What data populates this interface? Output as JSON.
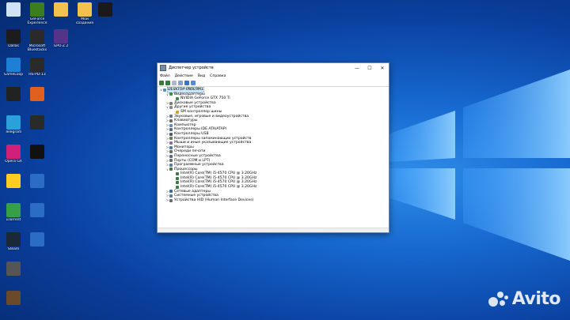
{
  "window": {
    "title": "Диспетчер устройств",
    "minimize_glyph": "—",
    "maximize_glyph": "☐",
    "close_glyph": "✕",
    "menu": [
      "Файл",
      "Действие",
      "Вид",
      "Справка"
    ]
  },
  "tree": [
    {
      "text": "DESKTOP-0N0E9M1",
      "level": 0,
      "expander": "∨",
      "icon": "computer-icon",
      "selected": true
    },
    {
      "text": "Видеоадаптеры",
      "level": 1,
      "expander": "∨",
      "icon": "display-adapter-icon"
    },
    {
      "text": "NVIDIA GeForce GTX 750 Ti",
      "level": 2,
      "expander": "",
      "icon": "display-adapter-icon"
    },
    {
      "text": "Дисковые устройства",
      "level": 1,
      "expander": ">",
      "icon": "disk-icon"
    },
    {
      "text": "Другие устройства",
      "level": 1,
      "expander": "∨",
      "icon": "unknown-device-icon"
    },
    {
      "text": "SM контроллер шины",
      "level": 2,
      "expander": "",
      "icon": "warning-device-icon"
    },
    {
      "text": "Звуковые, игровые и видеоустройства",
      "level": 1,
      "expander": ">",
      "icon": "speaker-icon"
    },
    {
      "text": "Клавиатуры",
      "level": 1,
      "expander": ">",
      "icon": "keyboard-icon"
    },
    {
      "text": "Компьютер",
      "level": 1,
      "expander": ">",
      "icon": "computer-icon"
    },
    {
      "text": "Контроллеры IDE ATA/ATAPI",
      "level": 1,
      "expander": ">",
      "icon": "ide-icon"
    },
    {
      "text": "Контроллеры USB",
      "level": 1,
      "expander": ">",
      "icon": "usb-icon"
    },
    {
      "text": "Контроллеры запоминающих устройств",
      "level": 1,
      "expander": ">",
      "icon": "storage-icon"
    },
    {
      "text": "Мыши и иные указывающие устройства",
      "level": 1,
      "expander": ">",
      "icon": "mouse-icon"
    },
    {
      "text": "Мониторы",
      "level": 1,
      "expander": ">",
      "icon": "monitor-icon"
    },
    {
      "text": "Очереди печати",
      "level": 1,
      "expander": ">",
      "icon": "printer-icon"
    },
    {
      "text": "Переносные устройства",
      "level": 1,
      "expander": ">",
      "icon": "portable-icon"
    },
    {
      "text": "Порты (COM и LPT)",
      "level": 1,
      "expander": ">",
      "icon": "port-icon"
    },
    {
      "text": "Программные устройства",
      "level": 1,
      "expander": ">",
      "icon": "software-device-icon"
    },
    {
      "text": "Процессоры",
      "level": 1,
      "expander": "∨",
      "icon": "cpu-icon"
    },
    {
      "text": "Intel(R) Core(TM) i5-4570 CPU @ 3.20GHz",
      "level": 2,
      "expander": "",
      "icon": "cpu-icon"
    },
    {
      "text": "Intel(R) Core(TM) i5-4570 CPU @ 3.20GHz",
      "level": 2,
      "expander": "",
      "icon": "cpu-icon"
    },
    {
      "text": "Intel(R) Core(TM) i5-4570 CPU @ 3.20GHz",
      "level": 2,
      "expander": "",
      "icon": "cpu-icon"
    },
    {
      "text": "Intel(R) Core(TM) i5-4570 CPU @ 3.20GHz",
      "level": 2,
      "expander": "",
      "icon": "cpu-icon"
    },
    {
      "text": "Сетевые адаптеры",
      "level": 1,
      "expander": ">",
      "icon": "network-icon"
    },
    {
      "text": "Системные устройства",
      "level": 1,
      "expander": ">",
      "icon": "system-device-icon"
    },
    {
      "text": "Устройства HID (Human Interface Devices)",
      "level": 1,
      "expander": ">",
      "icon": "hid-icon"
    }
  ],
  "desktop_icons": [
    {
      "label": "",
      "icon": "recycle-bin-icon",
      "color": "#cfe3f7"
    },
    {
      "label": "GeForce Experience",
      "icon": "nvidia-icon",
      "color": "#3b7d1f"
    },
    {
      "label": "",
      "icon": "folder-icon",
      "color": "#f2c14e"
    },
    {
      "label": "Мои создания",
      "icon": "folder-icon",
      "color": "#f2c14e"
    },
    {
      "label": "",
      "icon": "app-icon",
      "color": "#1a1a1a"
    },
    {
      "label": "Dallas",
      "icon": "app-icon",
      "color": "#1c1c1c"
    },
    {
      "label": "Microsoft Bluestacks",
      "icon": "app-icon",
      "color": "#2a2a2a"
    },
    {
      "label": "GPU-Z 2",
      "icon": "app-icon",
      "color": "#553388"
    },
    {
      "label": "GameLoop",
      "icon": "app-icon",
      "color": "#1e7fd6"
    },
    {
      "label": "HS-PD-13",
      "icon": "app-icon",
      "color": "#2a2a2a"
    },
    {
      "label": "",
      "icon": "app-icon",
      "color": "#222222"
    },
    {
      "label": "",
      "icon": "app-icon",
      "color": "#e06020"
    },
    {
      "label": "Telegram",
      "icon": "telegram-icon",
      "color": "#2aa1da"
    },
    {
      "label": "",
      "icon": "app-icon",
      "color": "#2a2a2a"
    },
    {
      "label": "Opera GX",
      "icon": "opera-icon",
      "color": "#d0207a"
    },
    {
      "label": "",
      "icon": "app-icon",
      "color": "#111111"
    },
    {
      "label": "",
      "icon": "app-icon",
      "color": "#ffcc22"
    },
    {
      "label": "",
      "icon": "app-icon",
      "color": "#2b6cc4"
    },
    {
      "label": "uTorrent",
      "icon": "utorrent-icon",
      "color": "#35a046"
    },
    {
      "label": "",
      "icon": "app-icon",
      "color": "#2b6cc4"
    },
    {
      "label": "Steam",
      "icon": "steam-icon",
      "color": "#1b2838"
    },
    {
      "label": "",
      "icon": "app-icon",
      "color": "#2b6cc4"
    },
    {
      "label": "",
      "icon": "app-icon",
      "color": "#555555"
    },
    {
      "label": "",
      "icon": "app-icon",
      "color": "#6a4a2a"
    }
  ],
  "watermark": {
    "text": "Avito"
  }
}
